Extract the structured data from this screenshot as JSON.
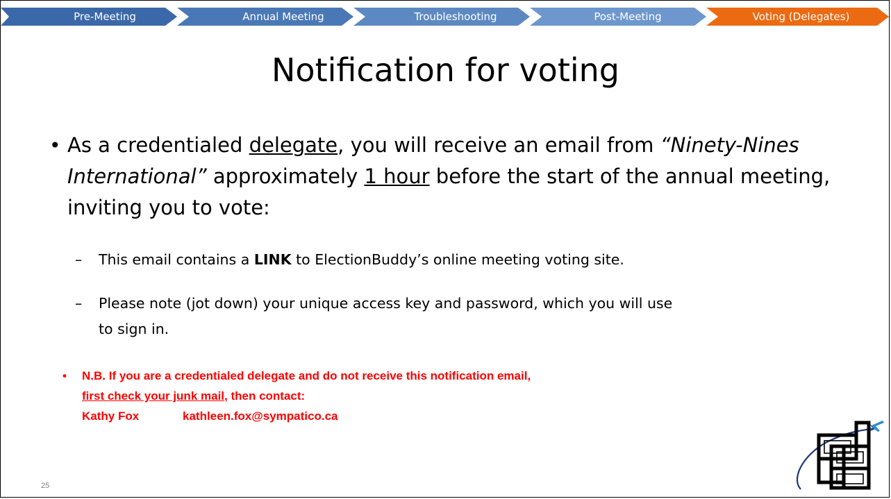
{
  "nav": {
    "steps": [
      {
        "label": "Pre-Meeting"
      },
      {
        "label": "Annual Meeting"
      },
      {
        "label": "Troubleshooting"
      },
      {
        "label": "Post-Meeting"
      },
      {
        "label": "Voting (Delegates)"
      }
    ],
    "active_index": 4,
    "colors": {
      "step_1": "#3b68a8",
      "step_2": "#4a78b6",
      "step_3": "#5d89c2",
      "step_4": "#6d97cd",
      "active": "#ec6a12"
    }
  },
  "title": "Notification for voting",
  "main_bullet": {
    "t1": "As a credentialed ",
    "t2_underline": "delegate",
    "t3": ", you will receive an email from ",
    "t4_italic": "“Ninety-Nines International”",
    "t5": " approximately ",
    "t6_underline": "1 hour",
    "t7": " before the start of the annual meeting, inviting you to vote:"
  },
  "sub_bullets": {
    "dash": "–",
    "b1": {
      "pre": "This email contains a ",
      "bold": "LINK",
      "post": " to ElectionBuddy’s online meeting voting site."
    },
    "b2": {
      "line1": "Please note (jot down) your unique access key and password, which you will use",
      "line2": "to sign in."
    }
  },
  "note": {
    "line1": "N.B. If you are a credentialed delegate and do not receive this notification email,",
    "line2_underline": "first check your junk mail",
    "line2_rest": ", then contact:",
    "contact_name": "Kathy Fox",
    "contact_email": "kathleen.fox@sympatico.ca",
    "color": "#ff0000"
  },
  "page_number": "25",
  "logo": {
    "icon": "ninety-nines-logo-icon"
  }
}
